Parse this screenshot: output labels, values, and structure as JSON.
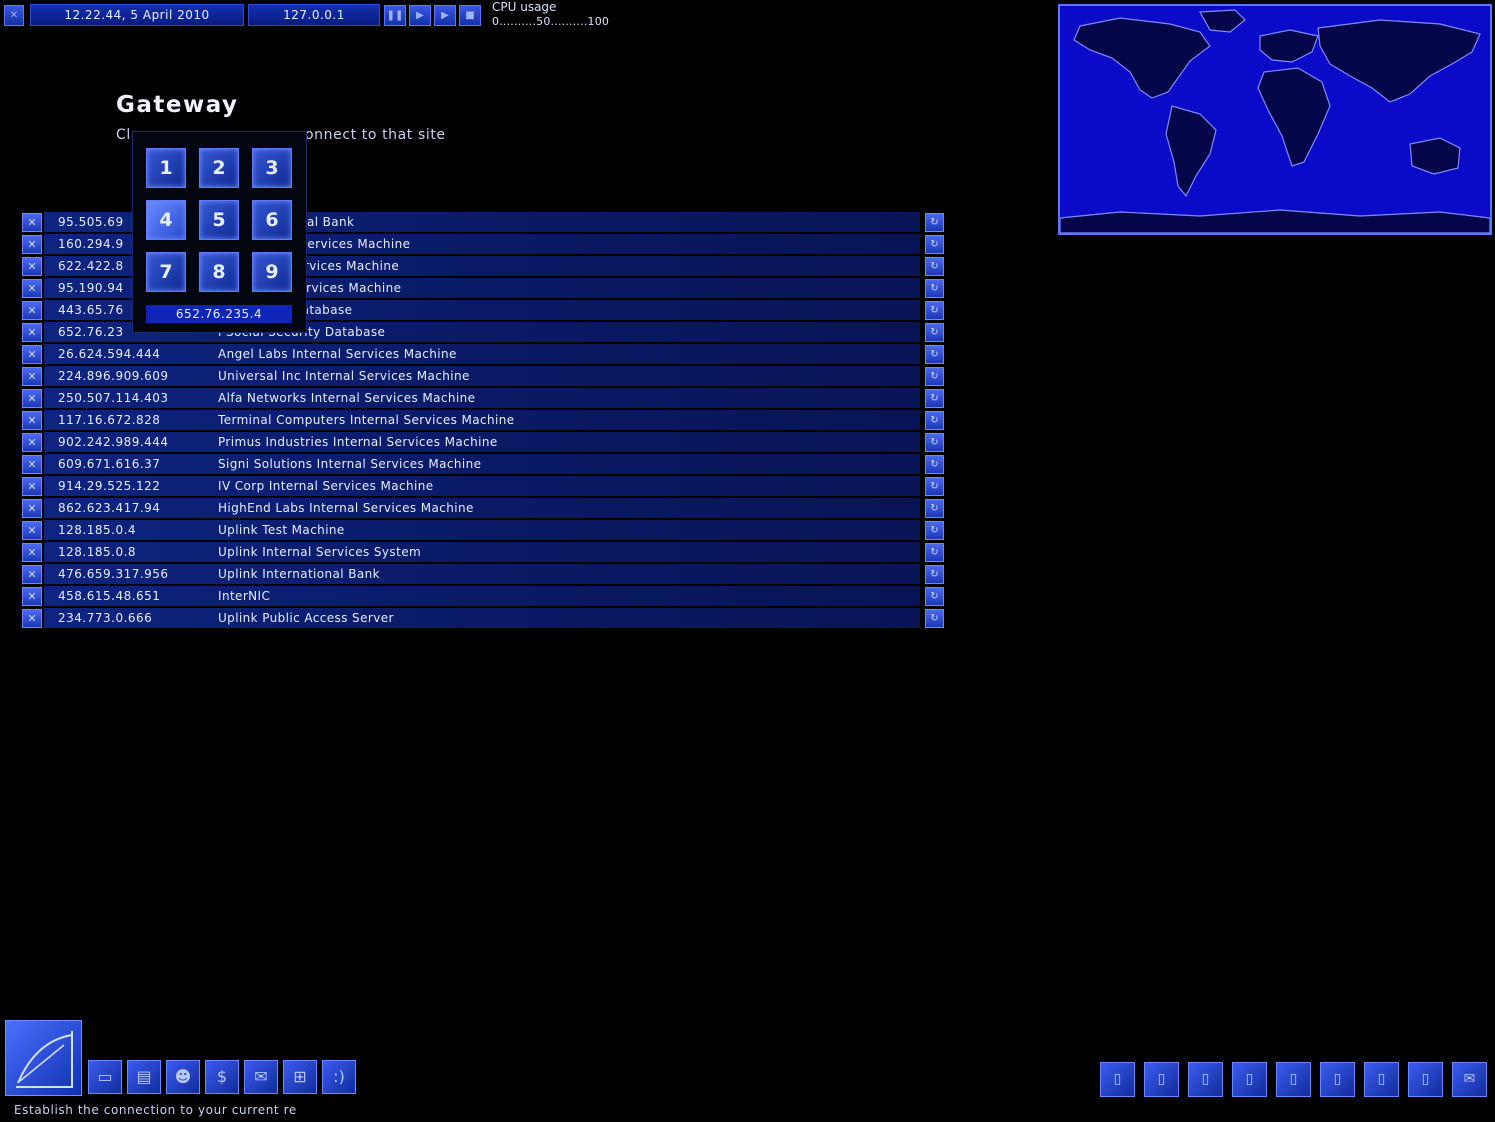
{
  "topbar": {
    "datetime": "12.22.44, 5 April 2010",
    "ip": "127.0.0.1",
    "speed_buttons": [
      "pause-icon",
      "play-icon",
      "fast-icon",
      "faster-icon"
    ],
    "cpu_label": "CPU usage",
    "cpu_scale": "0..........50..........100"
  },
  "page": {
    "title": "Gateway",
    "subtitle": "Click on the IP to connect to that site"
  },
  "subtitle_left": "Cl",
  "subtitle_right": "onnect to that site",
  "rows": [
    {
      "ip": "95.505.69",
      "name": "es International Bank"
    },
    {
      "ip": "160.294.9",
      "name": "ries Internal Services Machine"
    },
    {
      "ip": "622.422.8",
      "name": "h. Internal Services Machine"
    },
    {
      "ip": "95.190.94",
      "name": "es Internal Services Machine"
    },
    {
      "ip": "443.65.76",
      "name": "l Academic Database"
    },
    {
      "ip": "652.76.23",
      "name": "l Social Security Database"
    },
    {
      "ip": "26.624.594.444",
      "name": "Angel Labs Internal Services Machine"
    },
    {
      "ip": "224.896.909.609",
      "name": "Universal Inc Internal Services Machine"
    },
    {
      "ip": "250.507.114.403",
      "name": "Alfa Networks Internal Services Machine"
    },
    {
      "ip": "117.16.672.828",
      "name": "Terminal Computers Internal Services Machine"
    },
    {
      "ip": "902.242.989.444",
      "name": "Primus Industries Internal Services Machine"
    },
    {
      "ip": "609.671.616.37",
      "name": "Signi Solutions Internal Services Machine"
    },
    {
      "ip": "914.29.525.122",
      "name": "IV Corp Internal Services Machine"
    },
    {
      "ip": "862.623.417.94",
      "name": "HighEnd Labs Internal Services Machine"
    },
    {
      "ip": "128.185.0.4",
      "name": "Uplink Test Machine"
    },
    {
      "ip": "128.185.0.8",
      "name": "Uplink Internal Services System"
    },
    {
      "ip": "476.659.317.956",
      "name": "Uplink International Bank"
    },
    {
      "ip": "458.615.48.651",
      "name": "InterNIC"
    },
    {
      "ip": "234.773.0.666",
      "name": "Uplink Public Access Server"
    }
  ],
  "keypad": {
    "keys": [
      "1",
      "2",
      "3",
      "4",
      "5",
      "6",
      "7",
      "8",
      "9"
    ],
    "highlighted": "4",
    "display": "652.76.235.4"
  },
  "status_text": "Establish the connection to your current re",
  "bottom_icons": [
    "computer-icon",
    "files-icon",
    "people-icon",
    "finance-icon",
    "email-icon",
    "network-icon",
    "hud-icon"
  ],
  "right_icons": [
    "slot-1-icon",
    "slot-2-icon",
    "slot-3-icon",
    "slot-4-icon",
    "slot-5-icon",
    "slot-6-icon",
    "slot-7-icon",
    "slot-8-icon",
    "mail-icon"
  ],
  "colors": {
    "accent": "#1430b0",
    "row": "#0e2480",
    "map": "#0a0ac8"
  }
}
